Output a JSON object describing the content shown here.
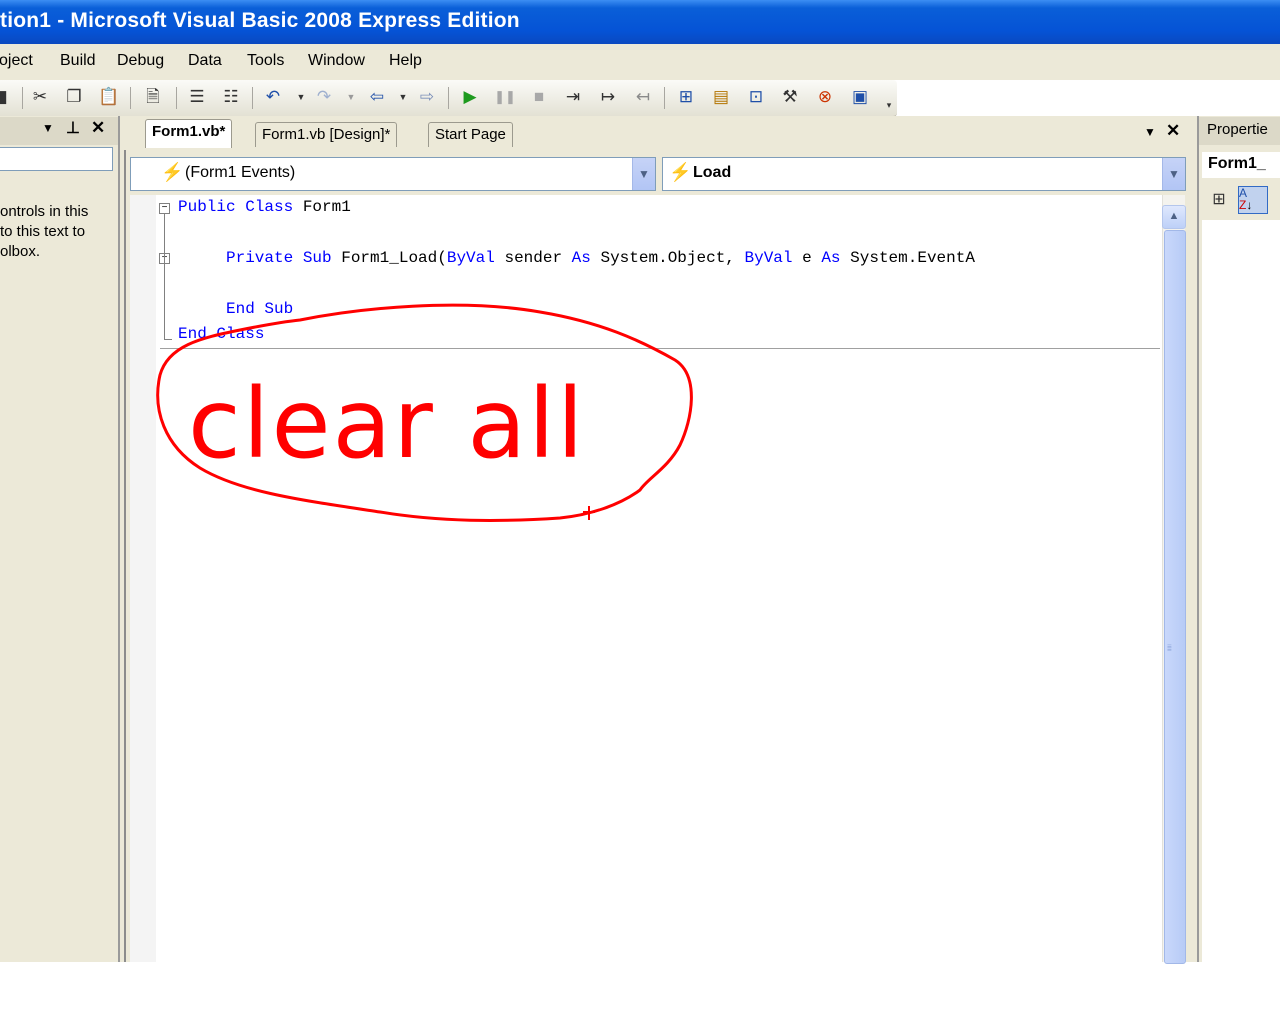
{
  "window": {
    "title": "tion1 - Microsoft Visual Basic 2008 Express Edition"
  },
  "menu": [
    "oject",
    "Build",
    "Debug",
    "Data",
    "Tools",
    "Window",
    "Help"
  ],
  "toolbox": {
    "hint_lines": [
      "ontrols in this",
      "to this text to",
      "olbox."
    ],
    "dropdown": "▼",
    "pin": "⊥",
    "close": "✕"
  },
  "tabs": [
    {
      "label": "Form1.vb*",
      "active": true
    },
    {
      "label": "Form1.vb [Design]*",
      "active": false
    },
    {
      "label": "Start Page",
      "active": false
    }
  ],
  "editor": {
    "class_combo": "(Form1 Events)",
    "method_combo": "Load",
    "tabs_dropdown": "▼",
    "tabs_close": "✕",
    "code_lines": [
      [
        {
          "t": "Public Class",
          "kw": true
        },
        {
          "t": " Form1",
          "kw": false
        }
      ],
      [
        {
          "t": "Private Sub",
          "kw": true
        },
        {
          "t": " Form1_Load(",
          "kw": false
        },
        {
          "t": "ByVal",
          "kw": true
        },
        {
          "t": " sender ",
          "kw": false
        },
        {
          "t": "As",
          "kw": true
        },
        {
          "t": " System.Object, ",
          "kw": false
        },
        {
          "t": "ByVal",
          "kw": true
        },
        {
          "t": " e ",
          "kw": false
        },
        {
          "t": "As",
          "kw": true
        },
        {
          "t": " System.EventA",
          "kw": false
        }
      ],
      [
        {
          "t": "End Sub",
          "kw": true
        }
      ],
      [
        {
          "t": "End Class",
          "kw": true
        }
      ]
    ]
  },
  "annotation": {
    "text": "clear all",
    "color": "#ff0000"
  },
  "properties": {
    "title": "Propertie",
    "object": "Form1_"
  },
  "colors": {
    "title_bar": "#0553d6",
    "keyword": "#0000ff",
    "chrome": "#ece9d8"
  }
}
